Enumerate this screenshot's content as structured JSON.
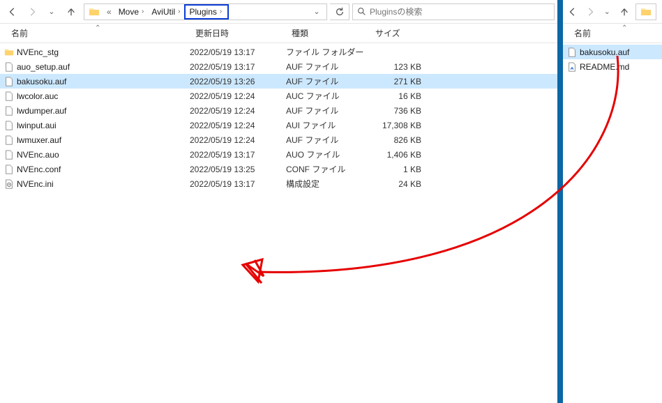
{
  "left": {
    "breadcrumbs": {
      "prefix": "«",
      "items": [
        "Move",
        "AviUtil",
        "Plugins"
      ],
      "highlight_index": 2
    },
    "search_placeholder": "Pluginsの検索",
    "columns": {
      "name": "名前",
      "date": "更新日時",
      "type": "種類",
      "size": "サイズ"
    },
    "files": [
      {
        "icon": "folder",
        "name": "NVEnc_stg",
        "date": "2022/05/19 13:17",
        "type": "ファイル フォルダー",
        "size": "",
        "selected": false
      },
      {
        "icon": "file",
        "name": "auo_setup.auf",
        "date": "2022/05/19 13:17",
        "type": "AUF ファイル",
        "size": "123 KB",
        "selected": false
      },
      {
        "icon": "file",
        "name": "bakusoku.auf",
        "date": "2022/05/19 13:26",
        "type": "AUF ファイル",
        "size": "271 KB",
        "selected": true
      },
      {
        "icon": "file",
        "name": "lwcolor.auc",
        "date": "2022/05/19 12:24",
        "type": "AUC ファイル",
        "size": "16 KB",
        "selected": false
      },
      {
        "icon": "file",
        "name": "lwdumper.auf",
        "date": "2022/05/19 12:24",
        "type": "AUF ファイル",
        "size": "736 KB",
        "selected": false
      },
      {
        "icon": "file",
        "name": "lwinput.aui",
        "date": "2022/05/19 12:24",
        "type": "AUI ファイル",
        "size": "17,308 KB",
        "selected": false
      },
      {
        "icon": "file",
        "name": "lwmuxer.auf",
        "date": "2022/05/19 12:24",
        "type": "AUF ファイル",
        "size": "826 KB",
        "selected": false
      },
      {
        "icon": "file",
        "name": "NVEnc.auo",
        "date": "2022/05/19 13:17",
        "type": "AUO ファイル",
        "size": "1,406 KB",
        "selected": false
      },
      {
        "icon": "file",
        "name": "NVEnc.conf",
        "date": "2022/05/19 13:25",
        "type": "CONF ファイル",
        "size": "1 KB",
        "selected": false
      },
      {
        "icon": "ini",
        "name": "NVEnc.ini",
        "date": "2022/05/19 13:17",
        "type": "構成設定",
        "size": "24 KB",
        "selected": false
      }
    ]
  },
  "right": {
    "columns": {
      "name": "名前"
    },
    "files": [
      {
        "icon": "file",
        "name": "bakusoku.auf",
        "selected": true
      },
      {
        "icon": "md",
        "name": "README.md",
        "selected": false
      }
    ]
  }
}
